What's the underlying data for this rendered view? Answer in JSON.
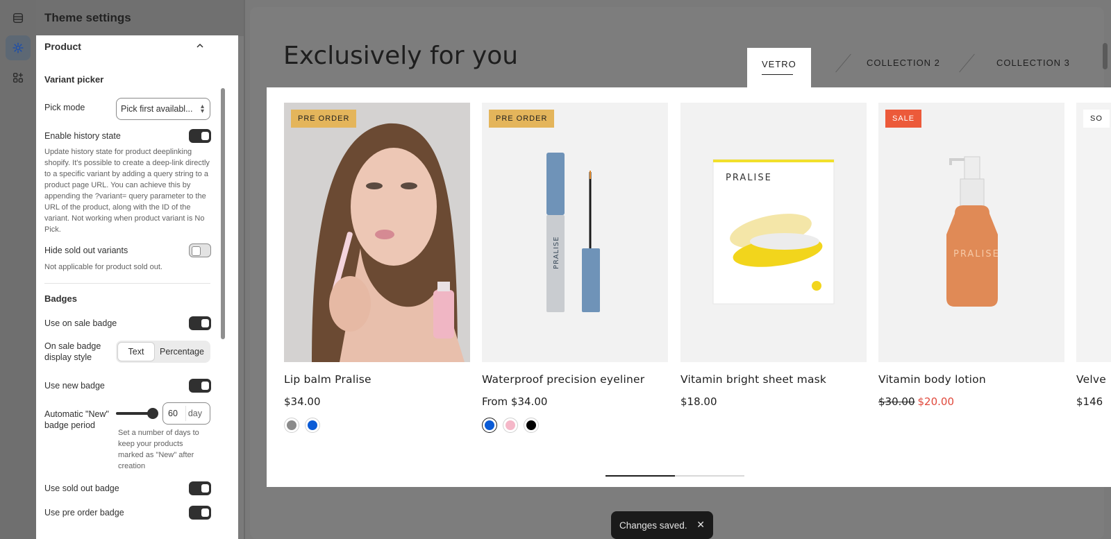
{
  "settings": {
    "title": "Theme settings",
    "section": "Product",
    "variant_picker": {
      "heading": "Variant picker",
      "pick_mode_label": "Pick mode",
      "pick_mode_value": "Pick first availabl...",
      "history_label": "Enable history state",
      "history_on": true,
      "history_help": "Update history state for product deeplinking shopify. It's possible to create a deep-link directly to a specific variant by adding a query string to a product page URL. You can achieve this by appending the ?variant= query parameter to the URL of the product, along with the ID of the variant. Not working when product variant is No Pick.",
      "hide_sold_label": "Hide sold out variants",
      "hide_sold_on": false,
      "hide_sold_help": "Not applicable for product sold out."
    },
    "badges": {
      "heading": "Badges",
      "sale_label": "Use on sale badge",
      "sale_on": true,
      "sale_style_label": "On sale badge display style",
      "sale_style_options": [
        "Text",
        "Percentage"
      ],
      "sale_style_selected": "Text",
      "new_label": "Use new badge",
      "new_on": true,
      "new_period_label": "Automatic \"New\" badge period",
      "new_period_value": "60",
      "new_period_unit": "day",
      "new_period_help": "Set a number of days to keep your products marked as \"New\" after creation",
      "sold_label": "Use sold out badge",
      "sold_on": true,
      "preorder_label": "Use pre order badge",
      "preorder_on": true
    }
  },
  "preview": {
    "title": "Exclusively for you",
    "tabs": [
      "VETRO",
      "COLLECTION 2",
      "COLLECTION 3"
    ],
    "active_tab": "VETRO",
    "products": [
      {
        "name": "Lip balm Pralise",
        "badge": "PRE ORDER",
        "price": "$34.00",
        "swatches": [
          "#8a8a8a",
          "#0a5bd6"
        ]
      },
      {
        "name": "Waterproof precision eyeliner",
        "badge": "PRE ORDER",
        "price": "From $34.00",
        "swatches": [
          "#0a5bd6",
          "#f5b7c8",
          "#000000"
        ]
      },
      {
        "name": "Vitamin bright sheet mask",
        "badge": "",
        "price": "$18.00",
        "swatches": []
      },
      {
        "name": "Vitamin body lotion",
        "badge": "SALE",
        "price_was": "$30.00",
        "price_now": "$20.00",
        "swatches": []
      },
      {
        "name": "Velve",
        "badge": "SO",
        "price": "$146",
        "swatches": []
      }
    ],
    "pack_text": "PRALISE",
    "slider_progress": 0.5
  },
  "toast": {
    "message": "Changes saved.",
    "close": "✕"
  }
}
